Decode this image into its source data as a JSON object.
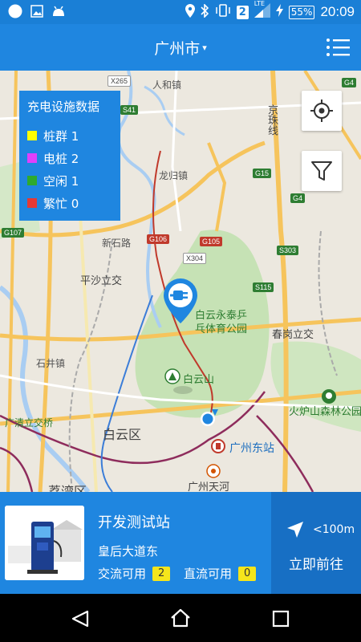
{
  "status_bar": {
    "time": "20:09",
    "battery": "55%",
    "network": "LTE",
    "sim": "2"
  },
  "app_bar": {
    "city": "广州市",
    "city_caret": "▾",
    "menu_icon": "list-menu-icon"
  },
  "legend": {
    "title": "充电设施数据",
    "items": [
      {
        "label": "桩群 1",
        "color": "#ffff00"
      },
      {
        "label": "电桩 2",
        "color": "#e040fb"
      },
      {
        "label": "空闲 1",
        "color": "#2eaa2e"
      },
      {
        "label": "繁忙 0",
        "color": "#e53935"
      }
    ]
  },
  "map": {
    "labels": {
      "renhe": "人和镇",
      "longgui": "龙归镇",
      "xinshilu": "新石路",
      "pingsha": "平沙立交",
      "shijing": "石井镇",
      "baiyun_district": "白云区",
      "guangqing": "广清立交桥",
      "lianxi": "荔湾区",
      "baiyunshan": "白云山",
      "yongtai": "白云永泰乒",
      "yongtai2": "乓体育公园",
      "chungang": "春岗立交",
      "huoludian": "火炉山森林公园",
      "jingzhu": "京珠线",
      "gz_east": "广州东站",
      "tianhe": "广州天河"
    },
    "shields": {
      "x265": "X265",
      "s41": "S41",
      "g4_top": "G4",
      "g15": "G15",
      "g4_mid": "G4",
      "g107": "G107",
      "g106": "G106",
      "g105": "G105",
      "x304": "X304",
      "s303": "S303",
      "s115": "S115"
    },
    "buttons": {
      "locate_icon": "crosshair-icon",
      "filter_icon": "filter-icon"
    },
    "pin_icon": "charging-plug-icon"
  },
  "station_card": {
    "name": "开发测试站",
    "address": "皇后大道东",
    "ac_label": "交流可用",
    "ac_count": "2",
    "dc_label": "直流可用",
    "dc_count": "0",
    "distance": "<100m",
    "go_label": "立即前往",
    "nav_icon": "navigation-arrow-icon"
  },
  "nav_bar": {
    "back_icon": "back-triangle-icon",
    "home_icon": "home-icon",
    "recents_icon": "recents-square-icon"
  }
}
